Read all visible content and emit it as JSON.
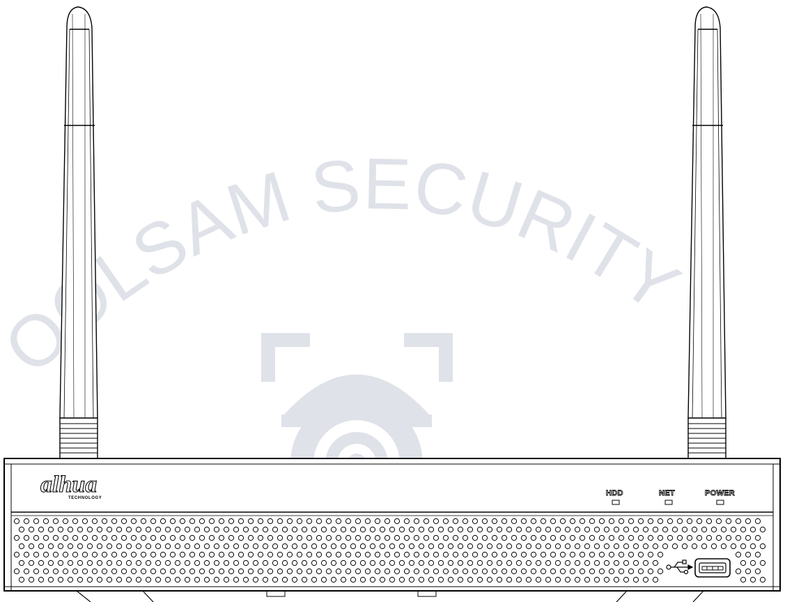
{
  "watermark": {
    "text": "OOLSAM SECURITY",
    "color": "#dfe2e8"
  },
  "device": {
    "brand": "alhua",
    "brand_subtitle": "TECHNOLOGY",
    "indicators": [
      {
        "label": "HDD"
      },
      {
        "label": "NET"
      },
      {
        "label": "POWER"
      }
    ],
    "usb_symbol": "usb-icon",
    "line_color": "#000000"
  }
}
